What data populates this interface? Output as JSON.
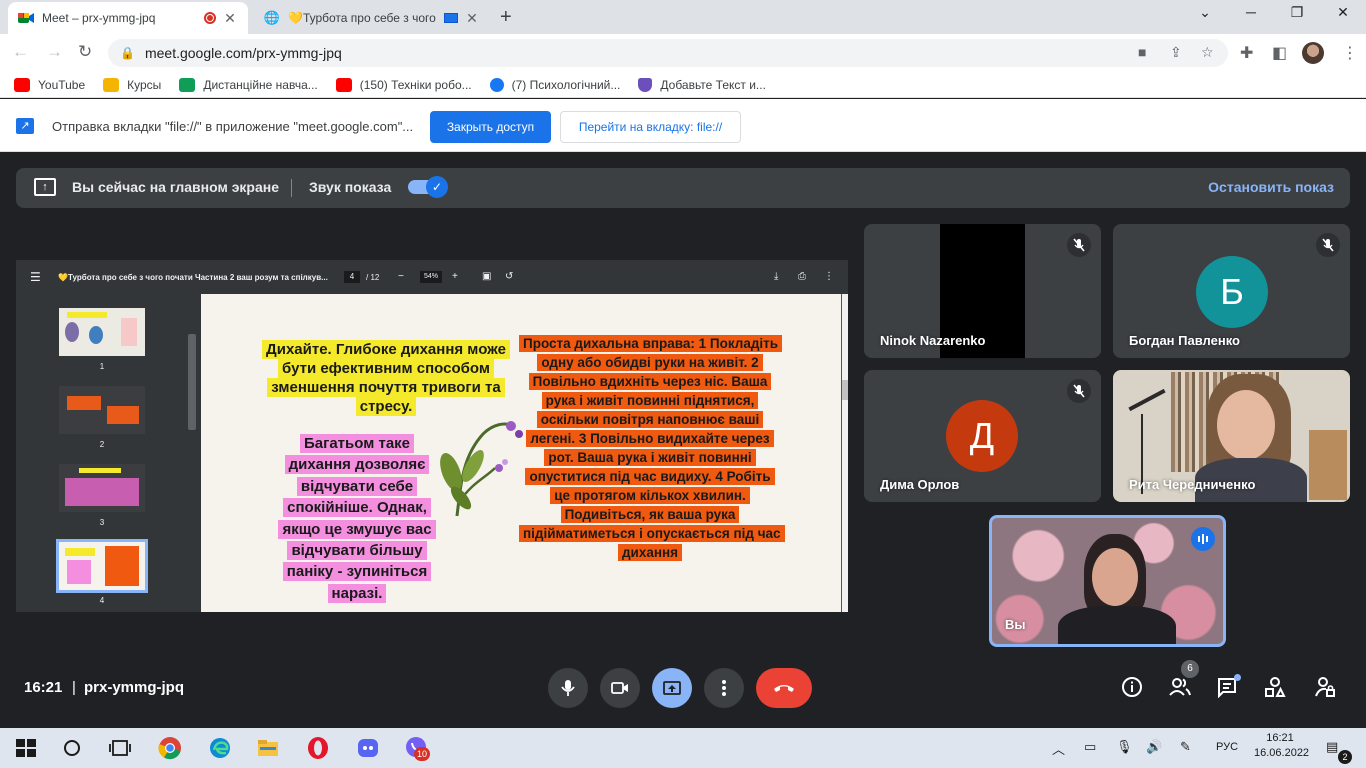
{
  "browser": {
    "tabs": [
      {
        "title": "Meet – prx-ymmg-jpq",
        "active": true
      },
      {
        "title": "💛Турбота про себе з чого",
        "active": false
      }
    ],
    "url": "meet.google.com/prx-ymmg-jpq",
    "bookmarks": [
      {
        "label": "YouTube",
        "icon": "youtube-icon",
        "color": "#ff0000"
      },
      {
        "label": "Курсы",
        "icon": "classroom-icon",
        "color": "#f4b400"
      },
      {
        "label": "Дистанційне навча...",
        "icon": "classroom-green-icon",
        "color": "#0f9d58"
      },
      {
        "label": "(150) Техніки робо...",
        "icon": "youtube-icon",
        "color": "#ff0000"
      },
      {
        "label": "(7) Психологічний...",
        "icon": "facebook-icon",
        "color": "#1877f2"
      },
      {
        "label": "Добавьте Текст и...",
        "icon": "shield-icon",
        "color": "#6b4fbb"
      }
    ]
  },
  "infobar": {
    "text": "Отправка вкладки \"file://\" в приложение \"meet.google.com\"...",
    "primary_label": "Закрыть доступ",
    "secondary_label": "Перейти на вкладку: file://"
  },
  "presenting_bar": {
    "main_text": "Вы сейчас на главном экране",
    "audio_label": "Звук показа",
    "stop_label": "Остановить показ"
  },
  "pdf": {
    "title": "💛Турбота про себе з чого почати Частина 2 ваш розум та спілкув...",
    "page": "4",
    "page_count": "/ 12",
    "zoom": "54%",
    "thumbnails": [
      "1",
      "2",
      "3",
      "4"
    ],
    "slide": {
      "yellow": "Дихайте. Глибоке дихання може бути ефективним способом зменшення почуття тривоги та стресу.",
      "pink": "Багатьом таке дихання дозволяє відчувати себе спокійніше. Однак, якщо це змушує вас відчувати більшу паніку - зупиніться наразі.",
      "orange": "Проста дихальна вправа: 1 Покладіть одну або обидві руки на живіт. 2 Повільно вдихніть через ніс. Ваша рука і живіт повинні піднятися, оскільки повітря наповнює ваші легені. 3 Повільно видихайте через рот. Ваша рука і живіт повинні опуститися під час видиху. 4 Робіть це протягом кількох хвилин. Подивіться, як ваша рука підійматиметься і опускається під час дихання"
    }
  },
  "participants": [
    {
      "name": "Ninok Nazarenko"
    },
    {
      "name": "Богдан Павленко",
      "letter": "Б",
      "color": "#12939a"
    },
    {
      "name": "Дима Орлов",
      "letter": "Д",
      "color": "#c5390f"
    },
    {
      "name": "Рита Чередниченко"
    },
    {
      "name": "Вы"
    }
  ],
  "meeting": {
    "time": "16:21",
    "code": "prx-ymmg-jpq",
    "people_count": "6"
  },
  "taskbar": {
    "lang": "РУС",
    "time": "16:21",
    "date": "16.06.2022",
    "viber_badge": "10",
    "notifications": "2"
  }
}
